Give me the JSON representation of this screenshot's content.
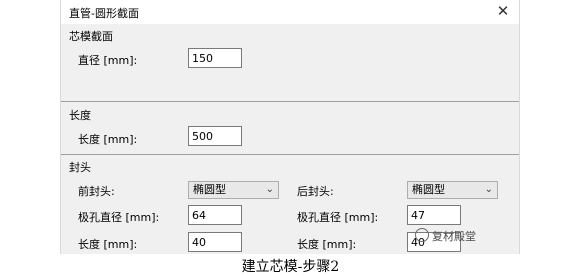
{
  "window": {
    "title": "直管-圆形截面",
    "close_glyph": "✕"
  },
  "core_section": {
    "heading": "芯模截面",
    "diameter_label": "直径 [mm]:",
    "diameter_value": "150"
  },
  "length_section": {
    "heading": "长度",
    "length_label": "长度 [mm]:",
    "length_value": "500"
  },
  "end_caps": {
    "heading": "封头",
    "front": {
      "type_label": "前封头:",
      "type_value": "椭圆型",
      "pole_diameter_label": "极孔直径 [mm]:",
      "pole_diameter_value": "64",
      "length_label": "长度 [mm]:",
      "length_value": "40"
    },
    "back": {
      "type_label": "后封头:",
      "type_value": "椭圆型",
      "pole_diameter_label": "极孔直径 [mm]:",
      "pole_diameter_value": "47",
      "length_label": "长度 [mm]:",
      "length_value": "40"
    }
  },
  "watermark": {
    "text": "复材殿堂"
  },
  "caption": {
    "text": "建立芯模-步骤2"
  },
  "icons": {
    "close": "close-icon",
    "dropdown": "chevron-down-icon"
  }
}
